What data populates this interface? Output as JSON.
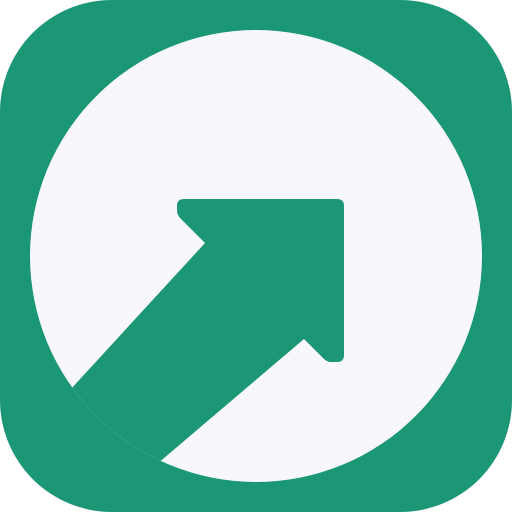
{
  "icon": {
    "name": "app-icon",
    "depicts": "external-link-arrow-icon",
    "colors": {
      "tile": "#1c9775",
      "circle": "#f8f8fc",
      "arrow": "#1c9775",
      "canvas_background": "#ffffff"
    }
  }
}
